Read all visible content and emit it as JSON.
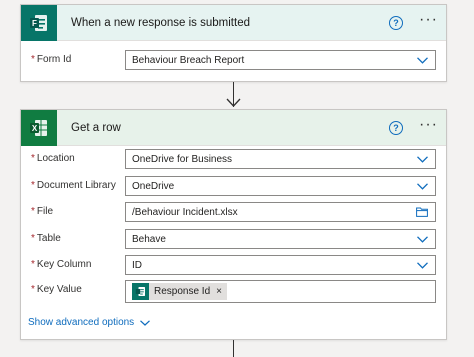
{
  "trigger": {
    "title": "When a new response is submitted",
    "icon": "forms-icon",
    "fields": [
      {
        "label": "Form Id",
        "required": "*",
        "value": "Behaviour Breach Report"
      }
    ]
  },
  "action": {
    "title": "Get a row",
    "icon": "excel-icon",
    "fields": [
      {
        "label": "Location",
        "required": "*",
        "value": "OneDrive for Business"
      },
      {
        "label": "Document Library",
        "required": "*",
        "value": "OneDrive"
      },
      {
        "label": "File",
        "required": "*",
        "value": "/Behaviour Incident.xlsx"
      },
      {
        "label": "Table",
        "required": "*",
        "value": "Behave"
      },
      {
        "label": "Key Column",
        "required": "*",
        "value": "ID"
      },
      {
        "label": "Key Value",
        "required": "*",
        "token": "Response Id",
        "token_close": "×"
      }
    ],
    "advanced_label": "Show advanced options"
  },
  "help_glyph": "?",
  "more_glyph": "···",
  "colors": {
    "forms_brand": "#077568",
    "excel_brand": "#107c41",
    "link": "#0f6cbd",
    "required": "#a4262c"
  }
}
